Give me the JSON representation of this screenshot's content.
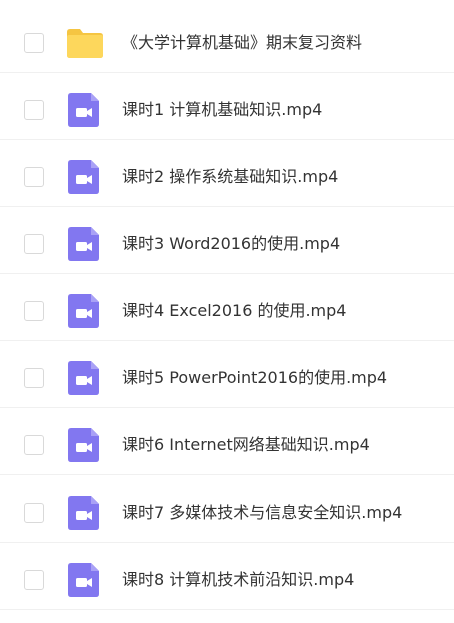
{
  "files": [
    {
      "name": "《大学计算机基础》期末复习资料",
      "icon": "folder-icon",
      "type": "folder"
    },
    {
      "name": "课时1 计算机基础知识.mp4",
      "icon": "video-file-icon",
      "type": "video"
    },
    {
      "name": "课时2 操作系统基础知识.mp4",
      "icon": "video-file-icon",
      "type": "video"
    },
    {
      "name": "课时3 Word2016的使用.mp4",
      "icon": "video-file-icon",
      "type": "video"
    },
    {
      "name": "课时4 Excel2016 的使用.mp4",
      "icon": "video-file-icon",
      "type": "video"
    },
    {
      "name": "课时5 PowerPoint2016的使用.mp4",
      "icon": "video-file-icon",
      "type": "video"
    },
    {
      "name": "课时6 Internet网络基础知识.mp4",
      "icon": "video-file-icon",
      "type": "video"
    },
    {
      "name": "课时7 多媒体技术与信息安全知识.mp4",
      "icon": "video-file-icon",
      "type": "video"
    },
    {
      "name": "课时8 计算机技术前沿知识.mp4",
      "icon": "video-file-icon",
      "type": "video"
    }
  ],
  "colors": {
    "folder": "#FDD75C",
    "folder_tab": "#F5C542",
    "video": "#8277F0",
    "video_fold": "#A9A1F6",
    "text": "#333333",
    "divider": "#F0F0F0"
  }
}
